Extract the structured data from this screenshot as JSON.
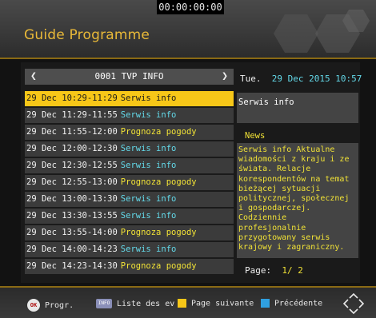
{
  "timecode": "00:00:00:00",
  "header": {
    "title": "Guide Programme"
  },
  "channel": {
    "label": "0001 TVP INFO",
    "prev_icon": "chevron-left-icon",
    "next_icon": "chevron-right-icon"
  },
  "datetime": {
    "day": "Tue.",
    "date": "29 Dec 2015 10:57"
  },
  "events": [
    {
      "time": "29 Dec 10:29-11:29",
      "title": "Serwis info",
      "color": "#63d8e8",
      "selected": true
    },
    {
      "time": "29 Dec 11:29-11:55",
      "title": "Serwis info",
      "color": "#63d8e8"
    },
    {
      "time": "29 Dec 11:55-12:00",
      "title": "Prognoza pogody",
      "color": "#f1e236"
    },
    {
      "time": "29 Dec 12:00-12:30",
      "title": "Serwis info",
      "color": "#63d8e8"
    },
    {
      "time": "29 Dec 12:30-12:55",
      "title": "Serwis info",
      "color": "#63d8e8"
    },
    {
      "time": "29 Dec 12:55-13:00",
      "title": "Prognoza pogody",
      "color": "#f1e236"
    },
    {
      "time": "29 Dec 13:00-13:30",
      "title": "Serwis info",
      "color": "#63d8e8"
    },
    {
      "time": "29 Dec 13:30-13:55",
      "title": "Serwis info",
      "color": "#63d8e8"
    },
    {
      "time": "29 Dec 13:55-14:00",
      "title": "Prognoza pogody",
      "color": "#f1e236"
    },
    {
      "time": "29 Dec 14:00-14:23",
      "title": "Serwis info",
      "color": "#63d8e8"
    },
    {
      "time": "29 Dec 14:23-14:30",
      "title": "Prognoza pogody",
      "color": "#f1e236"
    }
  ],
  "detail": {
    "title": "Serwis info",
    "genre": "News",
    "description": "Serwis info Aktualne wiadomości z kraju i ze świata. Relacje korespondentów na temat bieżącej sytuacji politycznej, społecznej i gospodarczej. Codziennie profesjonalnie przygotowany serwis krajowy i zagraniczny.",
    "page_label": "Page:",
    "page_num": "1/ 2"
  },
  "footer": {
    "ok_badge": "OK",
    "ok_label": "Progr.",
    "info_badge": "INFO",
    "info_label": "Liste des ev",
    "yellow_label": "Page suivante",
    "blue_label": "Précédente",
    "yellow_color": "#f7c718",
    "blue_color": "#2fa0e0",
    "nav_icon": "arrow-navigation-icon"
  },
  "colors": {
    "accent": "#e9b938",
    "selection": "#f7c718",
    "cyan_text": "#63d8e8",
    "yellow_text": "#f1e236"
  }
}
